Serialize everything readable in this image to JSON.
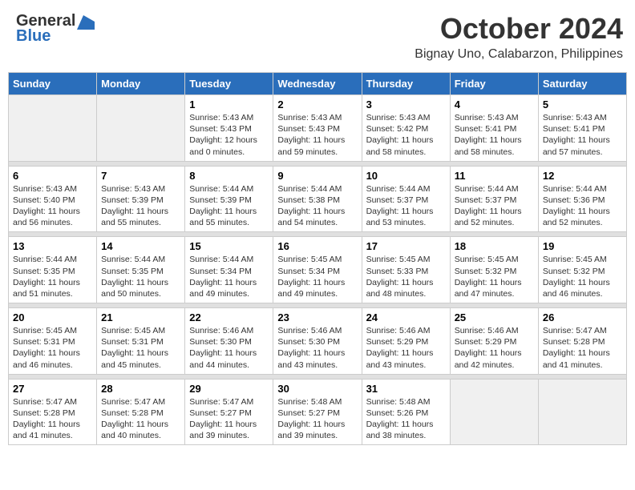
{
  "header": {
    "logo_general": "General",
    "logo_blue": "Blue",
    "month_title": "October 2024",
    "subtitle": "Bignay Uno, Calabarzon, Philippines"
  },
  "days_of_week": [
    "Sunday",
    "Monday",
    "Tuesday",
    "Wednesday",
    "Thursday",
    "Friday",
    "Saturday"
  ],
  "weeks": [
    {
      "days": [
        {
          "num": "",
          "info": ""
        },
        {
          "num": "",
          "info": ""
        },
        {
          "num": "1",
          "info": "Sunrise: 5:43 AM\nSunset: 5:43 PM\nDaylight: 12 hours\nand 0 minutes."
        },
        {
          "num": "2",
          "info": "Sunrise: 5:43 AM\nSunset: 5:43 PM\nDaylight: 11 hours\nand 59 minutes."
        },
        {
          "num": "3",
          "info": "Sunrise: 5:43 AM\nSunset: 5:42 PM\nDaylight: 11 hours\nand 58 minutes."
        },
        {
          "num": "4",
          "info": "Sunrise: 5:43 AM\nSunset: 5:41 PM\nDaylight: 11 hours\nand 58 minutes."
        },
        {
          "num": "5",
          "info": "Sunrise: 5:43 AM\nSunset: 5:41 PM\nDaylight: 11 hours\nand 57 minutes."
        }
      ]
    },
    {
      "days": [
        {
          "num": "6",
          "info": "Sunrise: 5:43 AM\nSunset: 5:40 PM\nDaylight: 11 hours\nand 56 minutes."
        },
        {
          "num": "7",
          "info": "Sunrise: 5:43 AM\nSunset: 5:39 PM\nDaylight: 11 hours\nand 55 minutes."
        },
        {
          "num": "8",
          "info": "Sunrise: 5:44 AM\nSunset: 5:39 PM\nDaylight: 11 hours\nand 55 minutes."
        },
        {
          "num": "9",
          "info": "Sunrise: 5:44 AM\nSunset: 5:38 PM\nDaylight: 11 hours\nand 54 minutes."
        },
        {
          "num": "10",
          "info": "Sunrise: 5:44 AM\nSunset: 5:37 PM\nDaylight: 11 hours\nand 53 minutes."
        },
        {
          "num": "11",
          "info": "Sunrise: 5:44 AM\nSunset: 5:37 PM\nDaylight: 11 hours\nand 52 minutes."
        },
        {
          "num": "12",
          "info": "Sunrise: 5:44 AM\nSunset: 5:36 PM\nDaylight: 11 hours\nand 52 minutes."
        }
      ]
    },
    {
      "days": [
        {
          "num": "13",
          "info": "Sunrise: 5:44 AM\nSunset: 5:35 PM\nDaylight: 11 hours\nand 51 minutes."
        },
        {
          "num": "14",
          "info": "Sunrise: 5:44 AM\nSunset: 5:35 PM\nDaylight: 11 hours\nand 50 minutes."
        },
        {
          "num": "15",
          "info": "Sunrise: 5:44 AM\nSunset: 5:34 PM\nDaylight: 11 hours\nand 49 minutes."
        },
        {
          "num": "16",
          "info": "Sunrise: 5:45 AM\nSunset: 5:34 PM\nDaylight: 11 hours\nand 49 minutes."
        },
        {
          "num": "17",
          "info": "Sunrise: 5:45 AM\nSunset: 5:33 PM\nDaylight: 11 hours\nand 48 minutes."
        },
        {
          "num": "18",
          "info": "Sunrise: 5:45 AM\nSunset: 5:32 PM\nDaylight: 11 hours\nand 47 minutes."
        },
        {
          "num": "19",
          "info": "Sunrise: 5:45 AM\nSunset: 5:32 PM\nDaylight: 11 hours\nand 46 minutes."
        }
      ]
    },
    {
      "days": [
        {
          "num": "20",
          "info": "Sunrise: 5:45 AM\nSunset: 5:31 PM\nDaylight: 11 hours\nand 46 minutes."
        },
        {
          "num": "21",
          "info": "Sunrise: 5:45 AM\nSunset: 5:31 PM\nDaylight: 11 hours\nand 45 minutes."
        },
        {
          "num": "22",
          "info": "Sunrise: 5:46 AM\nSunset: 5:30 PM\nDaylight: 11 hours\nand 44 minutes."
        },
        {
          "num": "23",
          "info": "Sunrise: 5:46 AM\nSunset: 5:30 PM\nDaylight: 11 hours\nand 43 minutes."
        },
        {
          "num": "24",
          "info": "Sunrise: 5:46 AM\nSunset: 5:29 PM\nDaylight: 11 hours\nand 43 minutes."
        },
        {
          "num": "25",
          "info": "Sunrise: 5:46 AM\nSunset: 5:29 PM\nDaylight: 11 hours\nand 42 minutes."
        },
        {
          "num": "26",
          "info": "Sunrise: 5:47 AM\nSunset: 5:28 PM\nDaylight: 11 hours\nand 41 minutes."
        }
      ]
    },
    {
      "days": [
        {
          "num": "27",
          "info": "Sunrise: 5:47 AM\nSunset: 5:28 PM\nDaylight: 11 hours\nand 41 minutes."
        },
        {
          "num": "28",
          "info": "Sunrise: 5:47 AM\nSunset: 5:28 PM\nDaylight: 11 hours\nand 40 minutes."
        },
        {
          "num": "29",
          "info": "Sunrise: 5:47 AM\nSunset: 5:27 PM\nDaylight: 11 hours\nand 39 minutes."
        },
        {
          "num": "30",
          "info": "Sunrise: 5:48 AM\nSunset: 5:27 PM\nDaylight: 11 hours\nand 39 minutes."
        },
        {
          "num": "31",
          "info": "Sunrise: 5:48 AM\nSunset: 5:26 PM\nDaylight: 11 hours\nand 38 minutes."
        },
        {
          "num": "",
          "info": ""
        },
        {
          "num": "",
          "info": ""
        }
      ]
    }
  ]
}
